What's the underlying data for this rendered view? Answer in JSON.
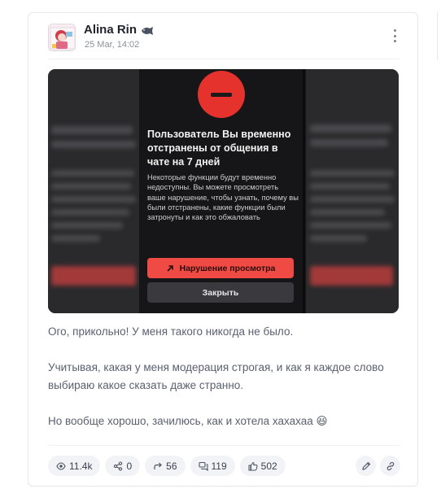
{
  "post": {
    "author": "Alina Rin",
    "author_badge_icon": "fish-icon",
    "date": "25 Mar, 14:02",
    "menu_icon": "more-vertical-icon",
    "image": {
      "modal_title": "Пользователь Вы временно отстранены от общения в чате на 7 дней",
      "modal_text": "Некоторые функции будут временно недоступны. Вы можете просмотреть ваше нарушение, чтобы узнать, почему вы были отстранены, какие функции были затронуты и как это обжаловать",
      "primary_button": "Нарушение просмотра",
      "secondary_button": "Закрыть",
      "accent_color": "#e5322d"
    },
    "paragraphs": [
      "Ого, прикольно! У меня такого никогда не было.",
      "Учитывая, какая у меня модерация строгая, и как я каждое слово выбираю какое сказать даже странно.",
      "Но вообще хорошо, зачилюсь, как и хотела хахахаа 😆"
    ]
  },
  "stats": {
    "views": "11.4k",
    "shares": "0",
    "reposts": "56",
    "comments": "119",
    "likes": "502"
  },
  "actions": {
    "edit_icon": "pencil-icon",
    "link_icon": "link-icon"
  }
}
